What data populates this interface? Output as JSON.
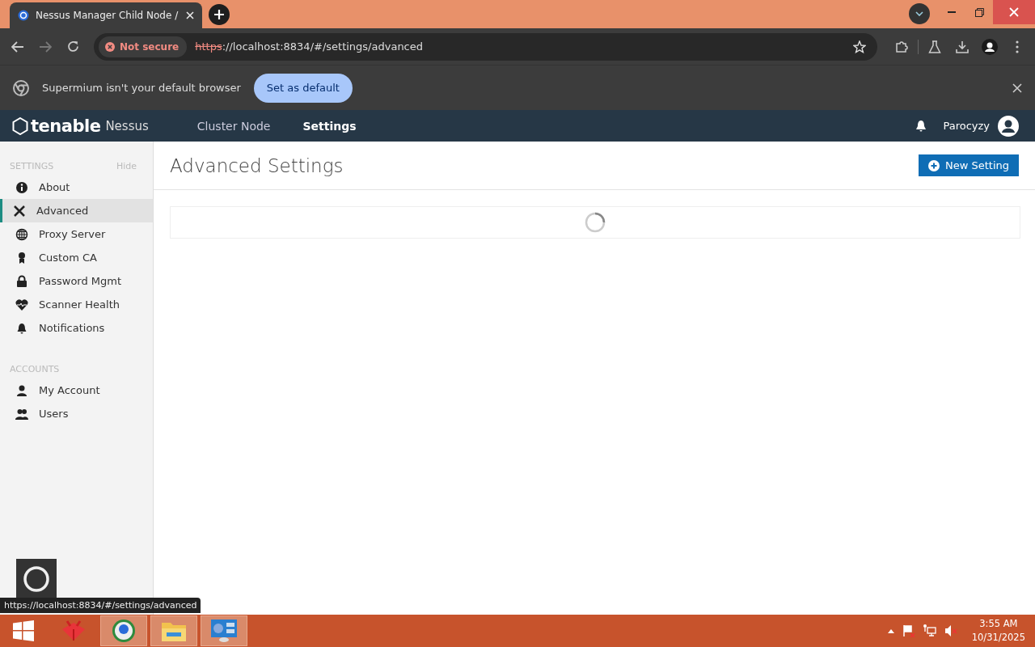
{
  "browser": {
    "tab": {
      "title": "Nessus Manager Child Node /",
      "selected": true
    },
    "security": "Not secure",
    "url_scheme": "https",
    "url_rest": "://localhost:8834/#/settings/advanced",
    "infobar": {
      "message": "Supermium isn't your default browser",
      "button": "Set as default"
    }
  },
  "app": {
    "logo_brand": "tenable",
    "logo_product": "Nessus",
    "nav": [
      {
        "label": "Cluster Node",
        "selected": false
      },
      {
        "label": "Settings",
        "selected": true
      }
    ],
    "user": "Parocyzy"
  },
  "sidebar": {
    "sections": [
      {
        "heading": "SETTINGS",
        "action": "Hide",
        "items": [
          {
            "label": "About",
            "selected": false
          },
          {
            "label": "Advanced",
            "selected": true
          },
          {
            "label": "Proxy Server",
            "selected": false
          },
          {
            "label": "Custom CA",
            "selected": false
          },
          {
            "label": "Password Mgmt",
            "selected": false
          },
          {
            "label": "Scanner Health",
            "selected": false
          },
          {
            "label": "Notifications",
            "selected": false
          }
        ]
      },
      {
        "heading": "ACCOUNTS",
        "items": [
          {
            "label": "My Account",
            "selected": false
          },
          {
            "label": "Users",
            "selected": false
          }
        ]
      }
    ]
  },
  "main": {
    "title": "Advanced Settings",
    "button": "New Setting",
    "loading": true
  },
  "status_url": "https://localhost:8834/#/settings/advanced",
  "taskbar": {
    "time": "3:55 AM",
    "date": "10/31/2025"
  }
}
